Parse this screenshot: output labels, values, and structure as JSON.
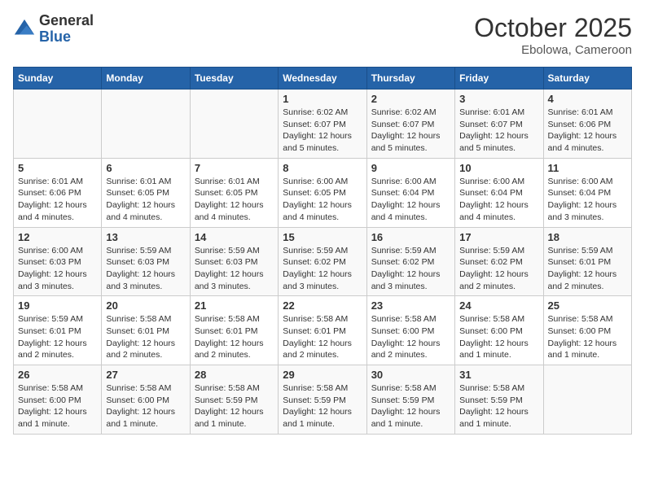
{
  "header": {
    "logo_general": "General",
    "logo_blue": "Blue",
    "month": "October 2025",
    "location": "Ebolowa, Cameroon"
  },
  "weekdays": [
    "Sunday",
    "Monday",
    "Tuesday",
    "Wednesday",
    "Thursday",
    "Friday",
    "Saturday"
  ],
  "weeks": [
    [
      {
        "day": "",
        "info": ""
      },
      {
        "day": "",
        "info": ""
      },
      {
        "day": "",
        "info": ""
      },
      {
        "day": "1",
        "info": "Sunrise: 6:02 AM\nSunset: 6:07 PM\nDaylight: 12 hours\nand 5 minutes."
      },
      {
        "day": "2",
        "info": "Sunrise: 6:02 AM\nSunset: 6:07 PM\nDaylight: 12 hours\nand 5 minutes."
      },
      {
        "day": "3",
        "info": "Sunrise: 6:01 AM\nSunset: 6:07 PM\nDaylight: 12 hours\nand 5 minutes."
      },
      {
        "day": "4",
        "info": "Sunrise: 6:01 AM\nSunset: 6:06 PM\nDaylight: 12 hours\nand 4 minutes."
      }
    ],
    [
      {
        "day": "5",
        "info": "Sunrise: 6:01 AM\nSunset: 6:06 PM\nDaylight: 12 hours\nand 4 minutes."
      },
      {
        "day": "6",
        "info": "Sunrise: 6:01 AM\nSunset: 6:05 PM\nDaylight: 12 hours\nand 4 minutes."
      },
      {
        "day": "7",
        "info": "Sunrise: 6:01 AM\nSunset: 6:05 PM\nDaylight: 12 hours\nand 4 minutes."
      },
      {
        "day": "8",
        "info": "Sunrise: 6:00 AM\nSunset: 6:05 PM\nDaylight: 12 hours\nand 4 minutes."
      },
      {
        "day": "9",
        "info": "Sunrise: 6:00 AM\nSunset: 6:04 PM\nDaylight: 12 hours\nand 4 minutes."
      },
      {
        "day": "10",
        "info": "Sunrise: 6:00 AM\nSunset: 6:04 PM\nDaylight: 12 hours\nand 4 minutes."
      },
      {
        "day": "11",
        "info": "Sunrise: 6:00 AM\nSunset: 6:04 PM\nDaylight: 12 hours\nand 3 minutes."
      }
    ],
    [
      {
        "day": "12",
        "info": "Sunrise: 6:00 AM\nSunset: 6:03 PM\nDaylight: 12 hours\nand 3 minutes."
      },
      {
        "day": "13",
        "info": "Sunrise: 5:59 AM\nSunset: 6:03 PM\nDaylight: 12 hours\nand 3 minutes."
      },
      {
        "day": "14",
        "info": "Sunrise: 5:59 AM\nSunset: 6:03 PM\nDaylight: 12 hours\nand 3 minutes."
      },
      {
        "day": "15",
        "info": "Sunrise: 5:59 AM\nSunset: 6:02 PM\nDaylight: 12 hours\nand 3 minutes."
      },
      {
        "day": "16",
        "info": "Sunrise: 5:59 AM\nSunset: 6:02 PM\nDaylight: 12 hours\nand 3 minutes."
      },
      {
        "day": "17",
        "info": "Sunrise: 5:59 AM\nSunset: 6:02 PM\nDaylight: 12 hours\nand 2 minutes."
      },
      {
        "day": "18",
        "info": "Sunrise: 5:59 AM\nSunset: 6:01 PM\nDaylight: 12 hours\nand 2 minutes."
      }
    ],
    [
      {
        "day": "19",
        "info": "Sunrise: 5:59 AM\nSunset: 6:01 PM\nDaylight: 12 hours\nand 2 minutes."
      },
      {
        "day": "20",
        "info": "Sunrise: 5:58 AM\nSunset: 6:01 PM\nDaylight: 12 hours\nand 2 minutes."
      },
      {
        "day": "21",
        "info": "Sunrise: 5:58 AM\nSunset: 6:01 PM\nDaylight: 12 hours\nand 2 minutes."
      },
      {
        "day": "22",
        "info": "Sunrise: 5:58 AM\nSunset: 6:01 PM\nDaylight: 12 hours\nand 2 minutes."
      },
      {
        "day": "23",
        "info": "Sunrise: 5:58 AM\nSunset: 6:00 PM\nDaylight: 12 hours\nand 2 minutes."
      },
      {
        "day": "24",
        "info": "Sunrise: 5:58 AM\nSunset: 6:00 PM\nDaylight: 12 hours\nand 1 minute."
      },
      {
        "day": "25",
        "info": "Sunrise: 5:58 AM\nSunset: 6:00 PM\nDaylight: 12 hours\nand 1 minute."
      }
    ],
    [
      {
        "day": "26",
        "info": "Sunrise: 5:58 AM\nSunset: 6:00 PM\nDaylight: 12 hours\nand 1 minute."
      },
      {
        "day": "27",
        "info": "Sunrise: 5:58 AM\nSunset: 6:00 PM\nDaylight: 12 hours\nand 1 minute."
      },
      {
        "day": "28",
        "info": "Sunrise: 5:58 AM\nSunset: 5:59 PM\nDaylight: 12 hours\nand 1 minute."
      },
      {
        "day": "29",
        "info": "Sunrise: 5:58 AM\nSunset: 5:59 PM\nDaylight: 12 hours\nand 1 minute."
      },
      {
        "day": "30",
        "info": "Sunrise: 5:58 AM\nSunset: 5:59 PM\nDaylight: 12 hours\nand 1 minute."
      },
      {
        "day": "31",
        "info": "Sunrise: 5:58 AM\nSunset: 5:59 PM\nDaylight: 12 hours\nand 1 minute."
      },
      {
        "day": "",
        "info": ""
      }
    ]
  ]
}
